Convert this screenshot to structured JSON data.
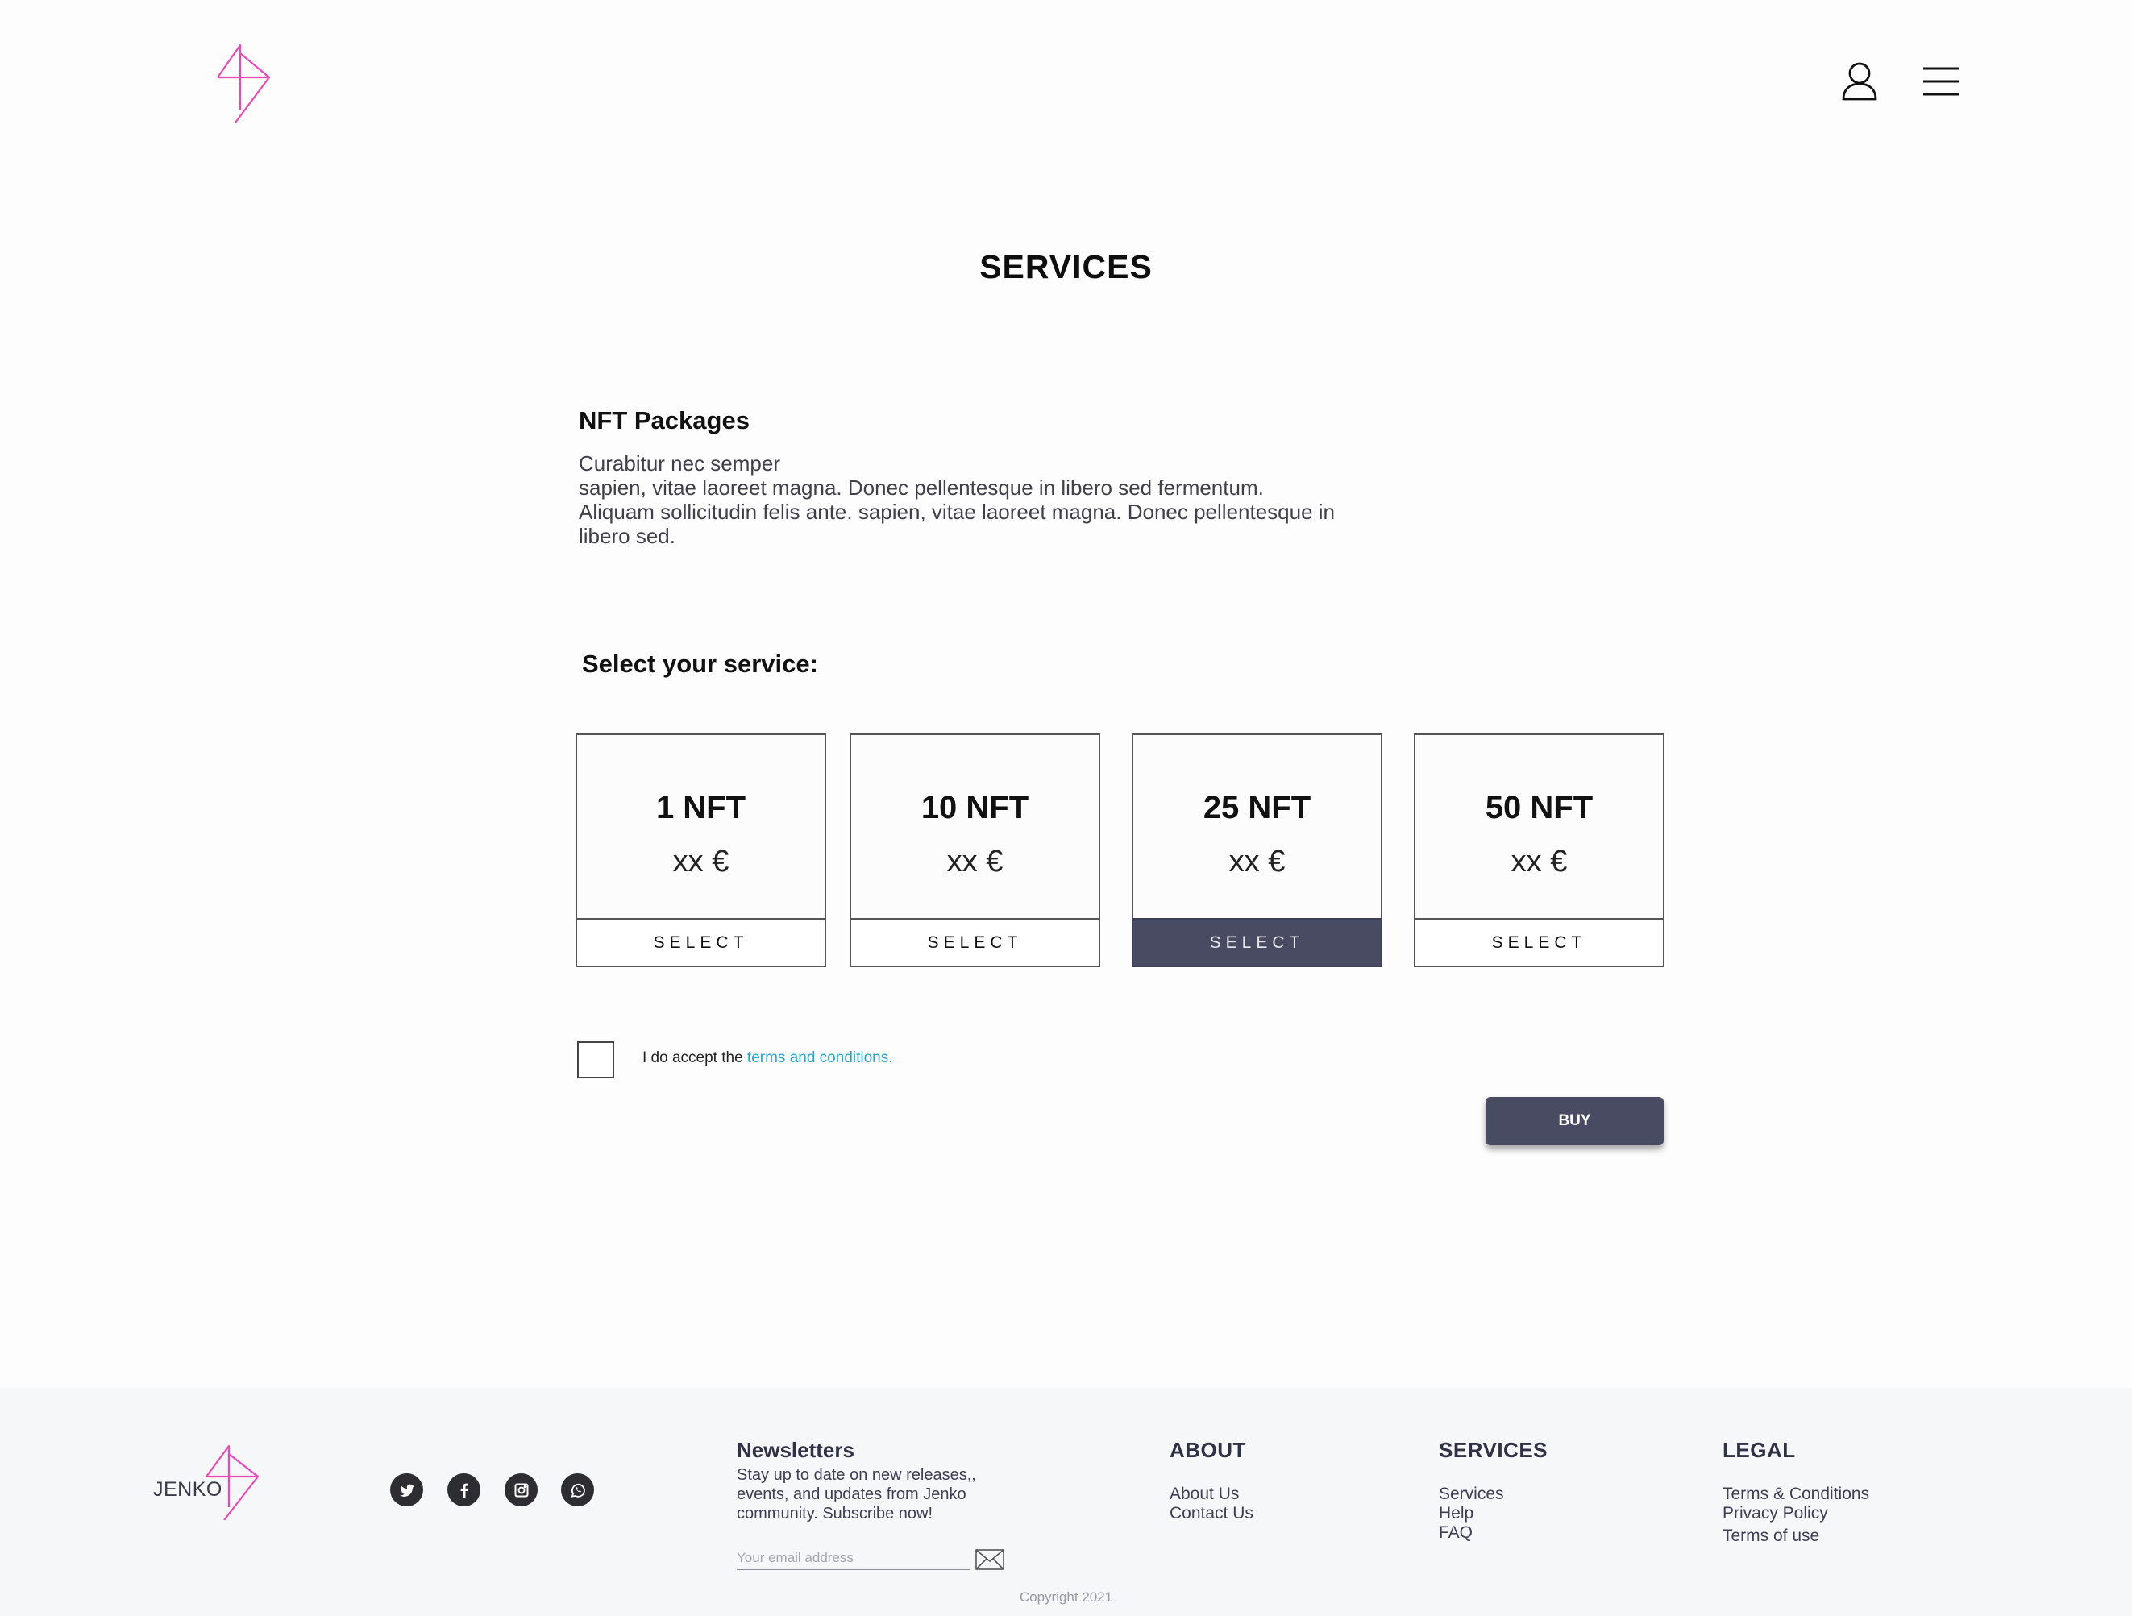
{
  "header": {
    "logo": "jenko-logo",
    "icons": [
      "user-icon",
      "menu-icon"
    ]
  },
  "page": {
    "title": "SERVICES"
  },
  "intro": {
    "heading": "NFT Packages",
    "lines": [
      "Curabitur nec semper",
      "sapien, vitae laoreet magna. Donec pellentesque in libero sed fermentum.",
      "Aliquam sollicitudin felis ante. sapien, vitae laoreet magna. Donec pellentesque in",
      "libero sed."
    ]
  },
  "services": {
    "heading": "Select your service:",
    "packages": [
      {
        "qty": "1 NFT",
        "price": "xx €",
        "button": "SELECT",
        "selected": false
      },
      {
        "qty": "10 NFT",
        "price": "xx €",
        "button": "SELECT",
        "selected": false
      },
      {
        "qty": "25 NFT",
        "price": "xx €",
        "button": "SELECT",
        "selected": true
      },
      {
        "qty": "50 NFT",
        "price": "xx €",
        "button": "SELECT",
        "selected": false
      }
    ]
  },
  "terms": {
    "checked": false,
    "text": "I do accept the ",
    "link": "terms and conditions."
  },
  "buy": {
    "label": "BUY"
  },
  "colors": {
    "accent": "#494b62",
    "brand_pink": "#ea48b8",
    "link": "#27a6cf"
  },
  "footer": {
    "brand": "JENKO",
    "social": [
      "twitter-icon",
      "facebook-icon",
      "instagram-icon",
      "whatsapp-icon"
    ],
    "newsletter": {
      "heading": "Newsletters",
      "text": "Stay up to date on new releases,, events, and updates from Jenko community. Subscribe now!",
      "placeholder": "Your email address",
      "value": ""
    },
    "about": {
      "heading": "ABOUT",
      "links": [
        "About Us",
        "Contact Us"
      ]
    },
    "services": {
      "heading": "SERVICES",
      "links": [
        "Services",
        "Help",
        "FAQ"
      ]
    },
    "legal": {
      "heading": "LEGAL",
      "links": [
        "Terms & Conditions",
        "Privacy Policy",
        "Terms of use"
      ]
    },
    "copyright": "Copyright 2021"
  }
}
